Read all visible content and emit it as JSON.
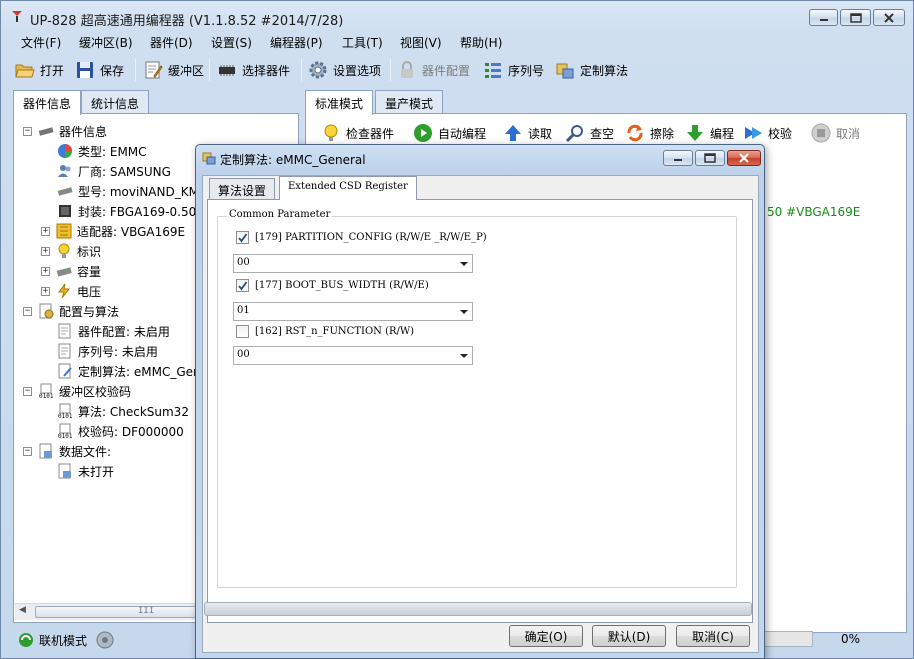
{
  "window": {
    "title": "UP-828 超高速通用编程器  (V1.1.8.52 #2014/7/28)"
  },
  "menu": [
    "文件(F)",
    "缓冲区(B)",
    "器件(D)",
    "设置(S)",
    "编程器(P)",
    "工具(T)",
    "视图(V)",
    "帮助(H)"
  ],
  "toolbar": {
    "open": "打开",
    "save": "保存",
    "buffer": "缓冲区",
    "select_device": "选择器件",
    "settings": "设置选项",
    "device_config": "器件配置",
    "serial": "序列号",
    "custom_algo": "定制算法"
  },
  "left_tabs": [
    "器件信息",
    "统计信息"
  ],
  "tree": {
    "device_info": "器件信息",
    "type": "类型: EMMC",
    "vendor": "厂商: SAMSUNG",
    "model": "型号: moviNAND_KM",
    "package": "封装: FBGA169-0.50",
    "adapter": "适配器: VBGA169E",
    "mark": "标识",
    "capacity": "容量",
    "voltage": "电压",
    "config_algo": "配置与算法",
    "device_config": "器件配置: 未启用",
    "serial": "序列号: 未启用",
    "custom_algo": "定制算法: eMMC_Gen",
    "checksum_group": "缓冲区校验码",
    "checksum_algo": "算法: CheckSum32",
    "checksum_value": "校验码: DF000000",
    "data_file": "数据文件:",
    "not_open": "未打开"
  },
  "scroll_mark": "III",
  "right_tabs": [
    "标准模式",
    "量产模式"
  ],
  "right_toolbar": {
    "check": "检查器件",
    "auto": "自动编程",
    "read": "读取",
    "blank": "查空",
    "erase": "擦除",
    "program": "编程",
    "verify": "校验",
    "cancel": "取消"
  },
  "right_text": "50 #VBGA169E",
  "status": {
    "mode": "联机模式",
    "progress": 0,
    "progress_text": "0%"
  },
  "dialog": {
    "title": "定制算法: eMMC_General",
    "tabs": [
      "算法设置",
      "Extended CSD Register"
    ],
    "group": "Common Parameter",
    "params": [
      {
        "label": "[179] PARTITION_CONFIG (R/W/E _R/W/E_P)",
        "checked": true,
        "value": "00"
      },
      {
        "label": "[177] BOOT_BUS_WIDTH (R/W/E)",
        "checked": true,
        "value": "01"
      },
      {
        "label": "[162] RST_n_FUNCTION (R/W)",
        "checked": false,
        "value": "00"
      }
    ],
    "buttons": {
      "ok": "确定(O)",
      "default": "默认(D)",
      "cancel": "取消(C)"
    }
  },
  "colors": {
    "green_text": "#1a8a1a",
    "accent": "#2a6fd1"
  }
}
